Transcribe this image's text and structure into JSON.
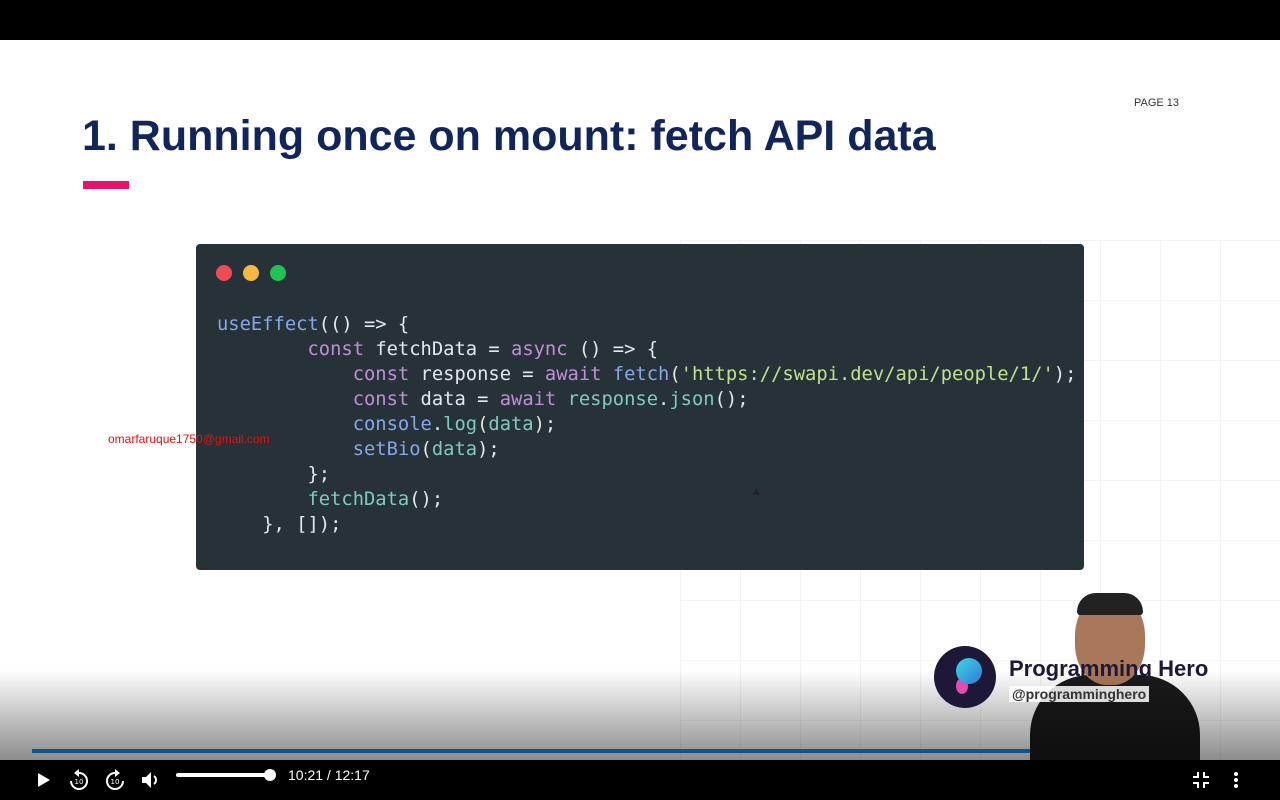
{
  "slide": {
    "page": "PAGE 13",
    "title": "1. Running once on mount: fetch API data",
    "accent": "#e5136a",
    "watermark_email": "omarfaruque1750@gmail.com",
    "window_dots": [
      "#ef4b55",
      "#f5b941",
      "#1fc552"
    ],
    "code_lines": [
      [
        [
          "useEffect",
          "fn"
        ],
        [
          "(() => {",
          "plain"
        ]
      ],
      [
        [
          "        ",
          "plain"
        ],
        [
          "const",
          "kw"
        ],
        [
          " fetchData = ",
          "plain"
        ],
        [
          "async",
          "kw"
        ],
        [
          " () => {",
          "plain"
        ]
      ],
      [
        [
          "            ",
          "plain"
        ],
        [
          "const",
          "kw"
        ],
        [
          " response = ",
          "plain"
        ],
        [
          "await",
          "kw"
        ],
        [
          " ",
          "plain"
        ],
        [
          "fetch",
          "fn"
        ],
        [
          "(",
          "plain"
        ],
        [
          "'https://swapi.dev/api/people/1/'",
          "str"
        ],
        [
          ");",
          "plain"
        ]
      ],
      [
        [
          "            ",
          "plain"
        ],
        [
          "const",
          "kw"
        ],
        [
          " data = ",
          "plain"
        ],
        [
          "await",
          "kw"
        ],
        [
          " ",
          "plain"
        ],
        [
          "response",
          "teal"
        ],
        [
          ".",
          "plain"
        ],
        [
          "json",
          "teal"
        ],
        [
          "();",
          "plain"
        ]
      ],
      [
        [
          "            ",
          "plain"
        ],
        [
          "console",
          "fn"
        ],
        [
          ".",
          "plain"
        ],
        [
          "log",
          "teal"
        ],
        [
          "(",
          "plain"
        ],
        [
          "data",
          "teal"
        ],
        [
          ");",
          "plain"
        ]
      ],
      [
        [
          "            ",
          "plain"
        ],
        [
          "setBio",
          "fn"
        ],
        [
          "(",
          "plain"
        ],
        [
          "data",
          "teal"
        ],
        [
          ");",
          "plain"
        ]
      ],
      [
        [
          "        };",
          "plain"
        ]
      ],
      [
        [
          "        ",
          "plain"
        ],
        [
          "fetchData",
          "teal"
        ],
        [
          "();",
          "plain"
        ]
      ],
      [
        [
          "    }, []);",
          "plain"
        ]
      ]
    ]
  },
  "brand": {
    "name": "Programming Hero",
    "handle": "@programminghero"
  },
  "player": {
    "current_time": "10:21",
    "duration": "12:17",
    "time_display": "10:21 / 12:17",
    "progress_percent": 84.3,
    "buffered_percent": 86.7,
    "volume_percent": 100,
    "accent": "#1a8fe8",
    "icons": [
      "play-icon",
      "rewind-10-icon",
      "forward-10-icon",
      "volume-icon",
      "exit-fullscreen-icon",
      "more-vert-icon"
    ]
  }
}
